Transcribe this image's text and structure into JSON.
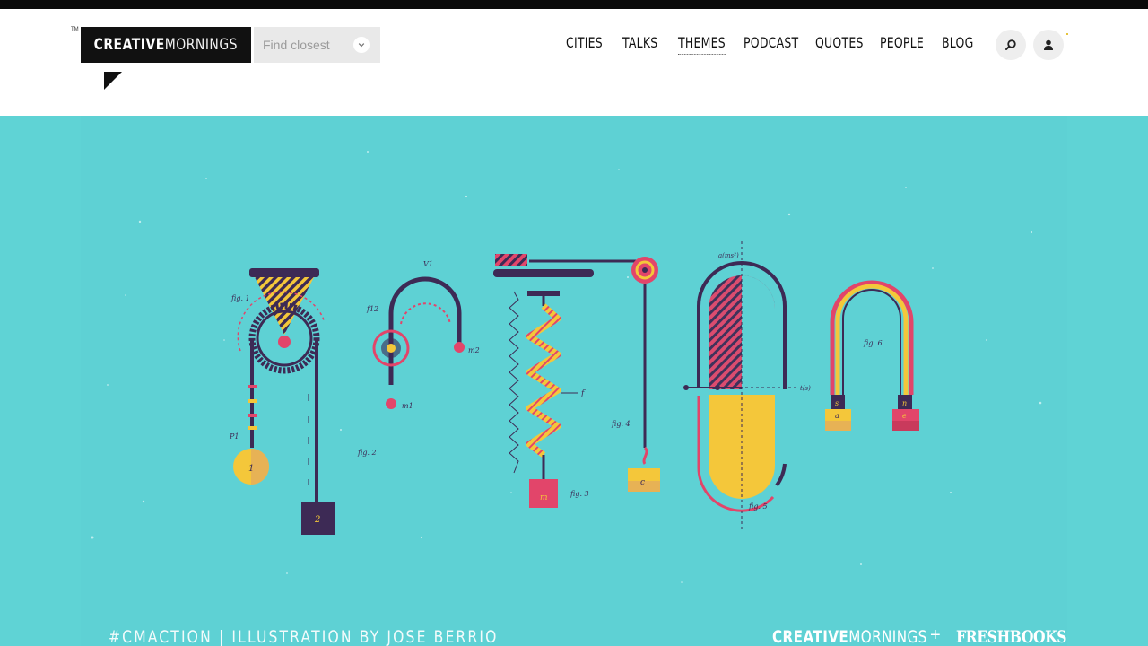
{
  "header": {
    "logo": {
      "trademark": "TM",
      "word_bold": "CREATIVE",
      "word_thin": "MORNINGS"
    },
    "city_select": {
      "placeholder": "Find closest"
    },
    "nav": [
      {
        "label": "CITIES",
        "active": false
      },
      {
        "label": "TALKS",
        "active": false
      },
      {
        "label": "THEMES",
        "active": true
      },
      {
        "label": "PODCAST",
        "active": false
      },
      {
        "label": "QUOTES",
        "active": false
      },
      {
        "label": "PEOPLE",
        "active": false
      },
      {
        "label": "BLOG",
        "active": false
      }
    ],
    "icons": {
      "search": "search-icon",
      "account": "user-icon"
    }
  },
  "hero": {
    "illustration_labels": {
      "fig1": "fig. 1",
      "fig2": "fig. 2",
      "fig3": "fig. 3",
      "fig4": "fig. 4",
      "fig5": "fig. 5",
      "fig6": "fig. 6",
      "v1": "V1",
      "f12": "f12",
      "m1": "m1",
      "m2": "m2",
      "p1": "P1",
      "f": "f",
      "accel": "a(ms²)",
      "time": "t(s)",
      "weight1": "1",
      "weight2": "2",
      "mass_m": "m",
      "mass_c": "c",
      "magnet_s": "s",
      "magnet_n": "n",
      "magnet_a": "a",
      "magnet_e": "e"
    },
    "credit": "#CMACTION | ILLUSTRATION BY JOSE BERRIO",
    "sponsor": {
      "cm_bold": "CREATIVE",
      "cm_thin": "MORNINGS",
      "plus": "+",
      "partner": "FRESHBOOKS"
    }
  },
  "colors": {
    "background": "#5ed1d4",
    "navy": "#3d2a55",
    "pink": "#e2456a",
    "yellow": "#f4c73a",
    "tan": "#e7b255",
    "header_black": "#111111"
  }
}
